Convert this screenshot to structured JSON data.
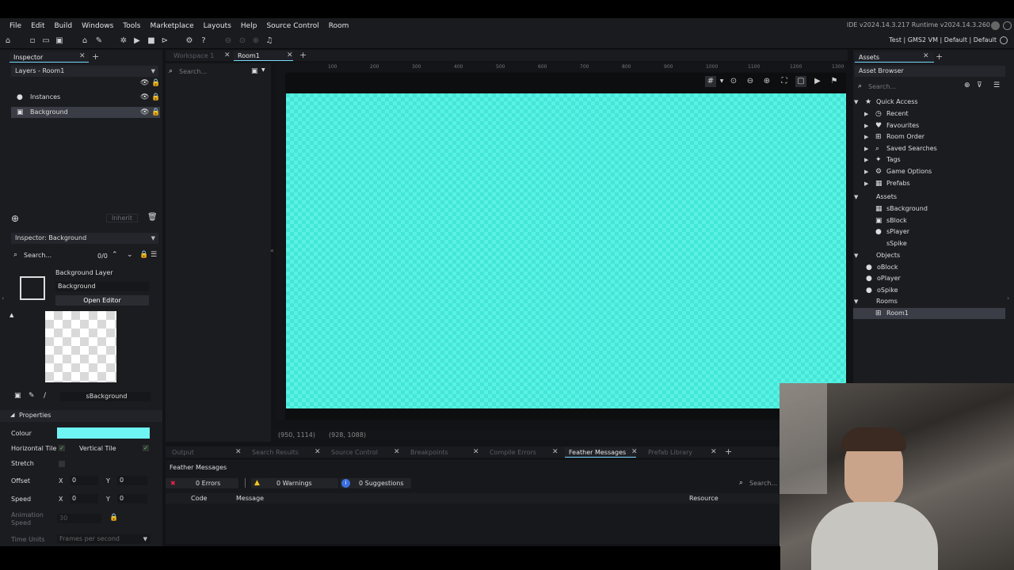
{
  "menu": [
    "File",
    "Edit",
    "Build",
    "Windows",
    "Tools",
    "Marketplace",
    "Help",
    "Layouts",
    "Source Control",
    "Room"
  ],
  "version": "IDE v2024.14.3.217  Runtime v2024.14.3.260",
  "target": "Test  |  GMS2 VM  |  Default  |  Default",
  "inspector": {
    "tab": "Inspector",
    "layers_dropdown": "Layers - Room1",
    "layers": [
      {
        "name": "Instances",
        "selected": false
      },
      {
        "name": "Background",
        "selected": true
      }
    ],
    "inherit_label": "Inherit",
    "inspector_dropdown": "Inspector: Background",
    "search_placeholder": "Search...",
    "search_count": "0/0",
    "layer_title": "Background Layer",
    "layer_name": "Background",
    "open_editor": "Open Editor",
    "sprite_name": "sBackground",
    "properties_label": "Properties",
    "colour_label": "Colour",
    "colour_value": "#6ff4f4",
    "htile_label": "Horizontal Tile",
    "vtile_label": "Vertical Tile",
    "stretch_label": "Stretch",
    "offset_label": "Offset",
    "speed_label": "Speed",
    "x_label": "X",
    "y_label": "Y",
    "offset_x": "0",
    "offset_y": "0",
    "speed_x": "0",
    "speed_y": "0",
    "anim_speed_label": "Animation Speed",
    "anim_speed_value": "30",
    "time_units_label": "Time Units",
    "time_units_value": "Frames per second"
  },
  "editor": {
    "tabs": [
      {
        "label": "Workspace 1",
        "active": false
      },
      {
        "label": "Room1",
        "active": true
      }
    ],
    "search_placeholder": "Search...",
    "ruler": [
      "100",
      "200",
      "300",
      "400",
      "500",
      "600",
      "700",
      "800",
      "900",
      "1000",
      "1100",
      "1200",
      "1300"
    ],
    "coords_mouse": "(950, 1114)",
    "coords_size": "(928, 1088)"
  },
  "output": {
    "tabs": [
      {
        "label": "Output",
        "active": false
      },
      {
        "label": "Search Results",
        "active": false
      },
      {
        "label": "Source Control",
        "active": false
      },
      {
        "label": "Breakpoints",
        "active": false
      },
      {
        "label": "Compile Errors",
        "active": false
      },
      {
        "label": "Feather Messages",
        "active": true
      },
      {
        "label": "Prefab Library",
        "active": false
      }
    ],
    "title": "Feather Messages",
    "errors": "0 Errors",
    "warnings": "0 Warnings",
    "suggestions": "0 Suggestions",
    "search_placeholder": "Search...",
    "col_code": "Code",
    "col_message": "Message",
    "col_resource": "Resource"
  },
  "assets": {
    "tab": "Assets",
    "browser_label": "Asset Browser",
    "search_placeholder": "Search...",
    "quick_access_label": "Quick Access",
    "quick_access": [
      "Recent",
      "Favourites",
      "Room Order",
      "Saved Searches",
      "Tags",
      "Game Options",
      "Prefabs"
    ],
    "assets_label": "Assets",
    "sprites": [
      "sBackground",
      "sBlock",
      "sPlayer",
      "sSpike"
    ],
    "objects_label": "Objects",
    "objects": [
      "oBlock",
      "oPlayer",
      "oSpike"
    ],
    "rooms_label": "Rooms",
    "rooms": [
      "Room1"
    ]
  }
}
